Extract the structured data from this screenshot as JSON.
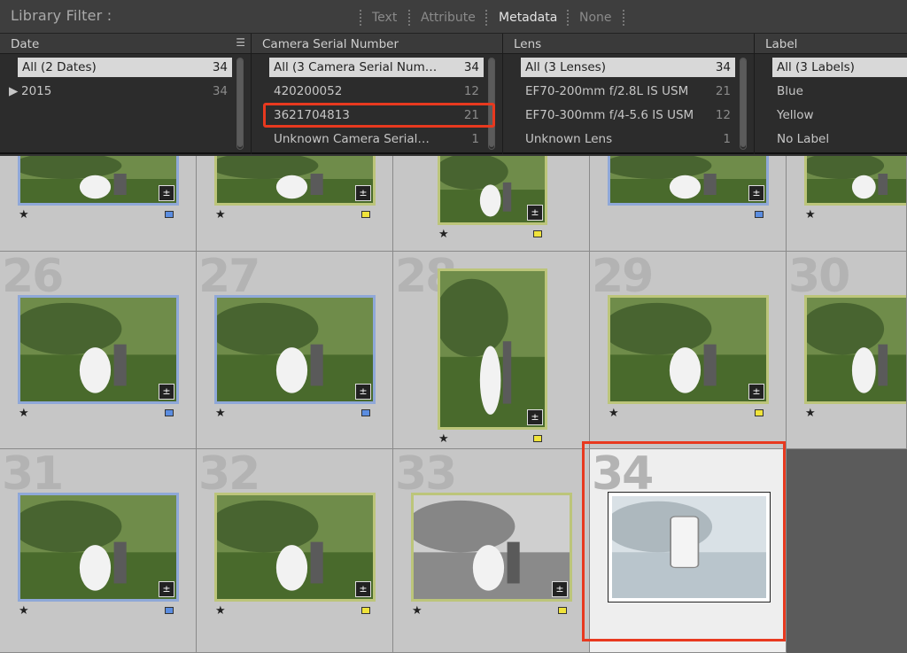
{
  "header": {
    "title": "Library Filter :",
    "tabs": [
      {
        "label": "Text",
        "active": false
      },
      {
        "label": "Attribute",
        "active": false
      },
      {
        "label": "Metadata",
        "active": true
      },
      {
        "label": "None",
        "active": false
      }
    ]
  },
  "filter_columns": [
    {
      "header": "Date",
      "rows": [
        {
          "label": "All (2 Dates)",
          "count": "34",
          "selected": true
        },
        {
          "label": "2015",
          "count": "34",
          "expandable": true
        }
      ]
    },
    {
      "header": "Camera Serial Number",
      "rows": [
        {
          "label": "All (3 Camera Serial Num…",
          "count": "34",
          "selected": true
        },
        {
          "label": "420200052",
          "count": "12"
        },
        {
          "label": "3621704813",
          "count": "21",
          "highlighted": true
        },
        {
          "label": "Unknown Camera Serial…",
          "count": "1"
        }
      ]
    },
    {
      "header": "Lens",
      "rows": [
        {
          "label": "All (3 Lenses)",
          "count": "34",
          "selected": true
        },
        {
          "label": "EF70-200mm f/2.8L IS USM",
          "count": "21"
        },
        {
          "label": "EF70-300mm f/4-5.6 IS USM",
          "count": "12"
        },
        {
          "label": "Unknown Lens",
          "count": "1"
        }
      ]
    },
    {
      "header": "Label",
      "rows": [
        {
          "label": "All (3 Labels)",
          "selected": true
        },
        {
          "label": "Blue"
        },
        {
          "label": "Yellow"
        },
        {
          "label": "No Label"
        }
      ]
    }
  ],
  "grid": {
    "top_row": [
      {
        "rating": "★",
        "label_color": "blue"
      },
      {
        "rating": "★",
        "label_color": "yellow"
      },
      {
        "rating": "★",
        "label_color": "yellow"
      },
      {
        "rating": "",
        "label_color": "blue"
      },
      {
        "rating": "★",
        "label_color": ""
      }
    ],
    "rows": [
      [
        {
          "number": "26",
          "rating": "★",
          "label_color": "blue"
        },
        {
          "number": "27",
          "rating": "★",
          "label_color": "blue"
        },
        {
          "number": "28",
          "rating": "★",
          "label_color": "yellow"
        },
        {
          "number": "29",
          "rating": "★",
          "label_color": "yellow"
        },
        {
          "number": "30",
          "rating": "★",
          "label_color": ""
        }
      ],
      [
        {
          "number": "31",
          "rating": "★",
          "label_color": "blue"
        },
        {
          "number": "32",
          "rating": "★",
          "label_color": "yellow"
        },
        {
          "number": "33",
          "rating": "★",
          "label_color": "yellow"
        },
        {
          "number": "34",
          "rating": "",
          "label_color": ""
        }
      ]
    ]
  },
  "colors": {
    "highlight": "#e8391f",
    "label_blue": "#5b8de0",
    "label_yellow": "#f0e33b"
  },
  "icons": {
    "develop_badge": "develop-adjustment-icon",
    "expand": "disclosure-triangle-icon",
    "column_menu": "column-menu-icon"
  }
}
